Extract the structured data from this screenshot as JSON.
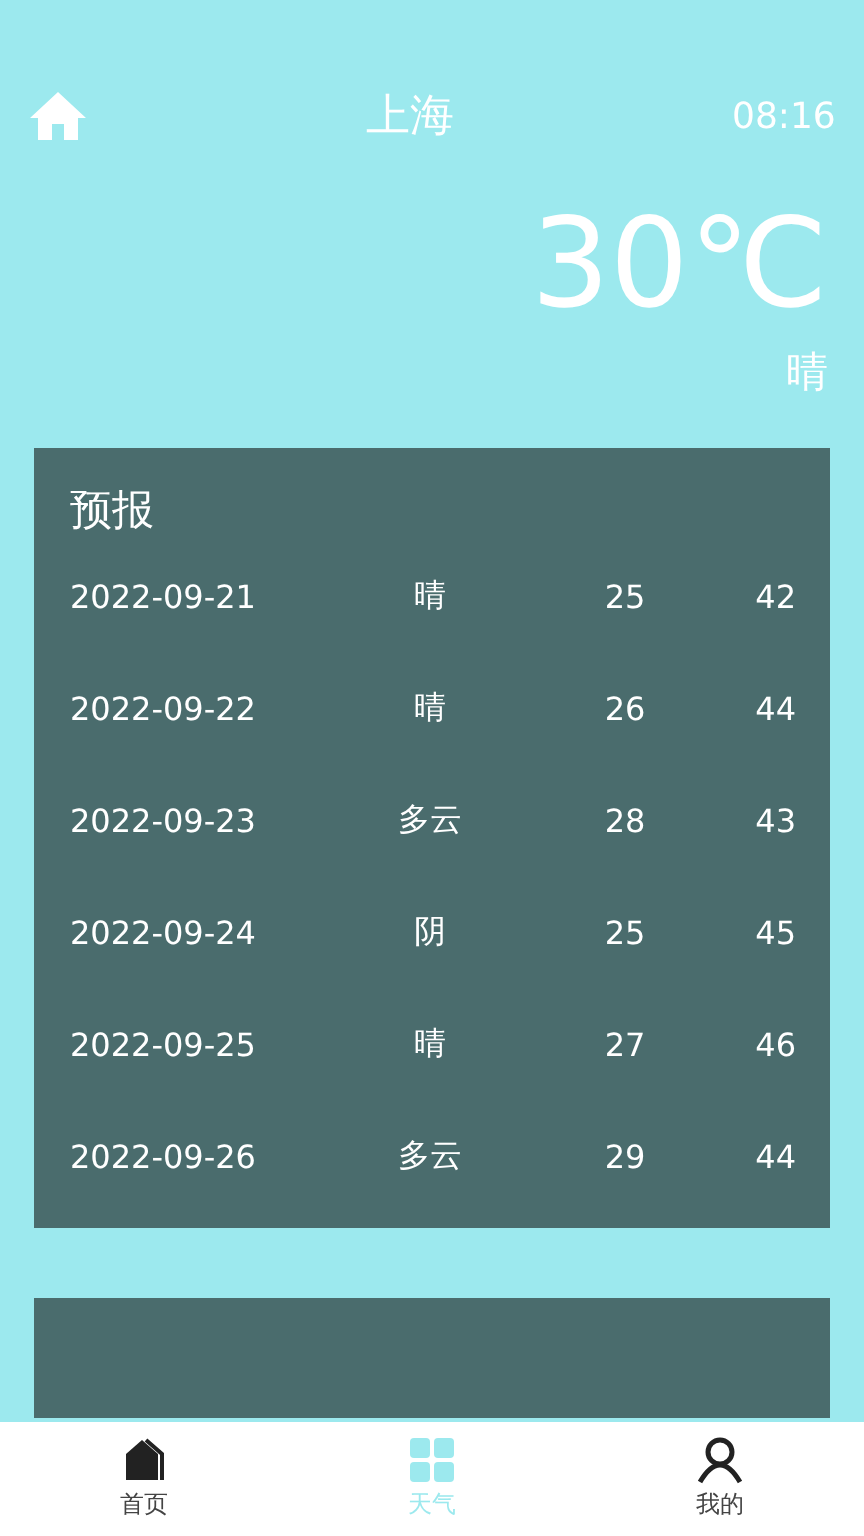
{
  "header": {
    "city": "上海",
    "time": "08:16"
  },
  "current": {
    "temperature": "30℃",
    "condition": "晴"
  },
  "forecast": {
    "title": "预报",
    "rows": [
      {
        "date": "2022-09-21",
        "condition": "晴",
        "low": "25",
        "high": "42"
      },
      {
        "date": "2022-09-22",
        "condition": "晴",
        "low": "26",
        "high": "44"
      },
      {
        "date": "2022-09-23",
        "condition": "多云",
        "low": "28",
        "high": "43"
      },
      {
        "date": "2022-09-24",
        "condition": "阴",
        "low": "25",
        "high": "45"
      },
      {
        "date": "2022-09-25",
        "condition": "晴",
        "low": "27",
        "high": "46"
      },
      {
        "date": "2022-09-26",
        "condition": "多云",
        "low": "29",
        "high": "44"
      }
    ]
  },
  "nav": [
    {
      "label": "首页",
      "kind": "home",
      "selected": false
    },
    {
      "label": "天气",
      "kind": "weather",
      "selected": true
    },
    {
      "label": "我的",
      "kind": "profile",
      "selected": false
    }
  ]
}
